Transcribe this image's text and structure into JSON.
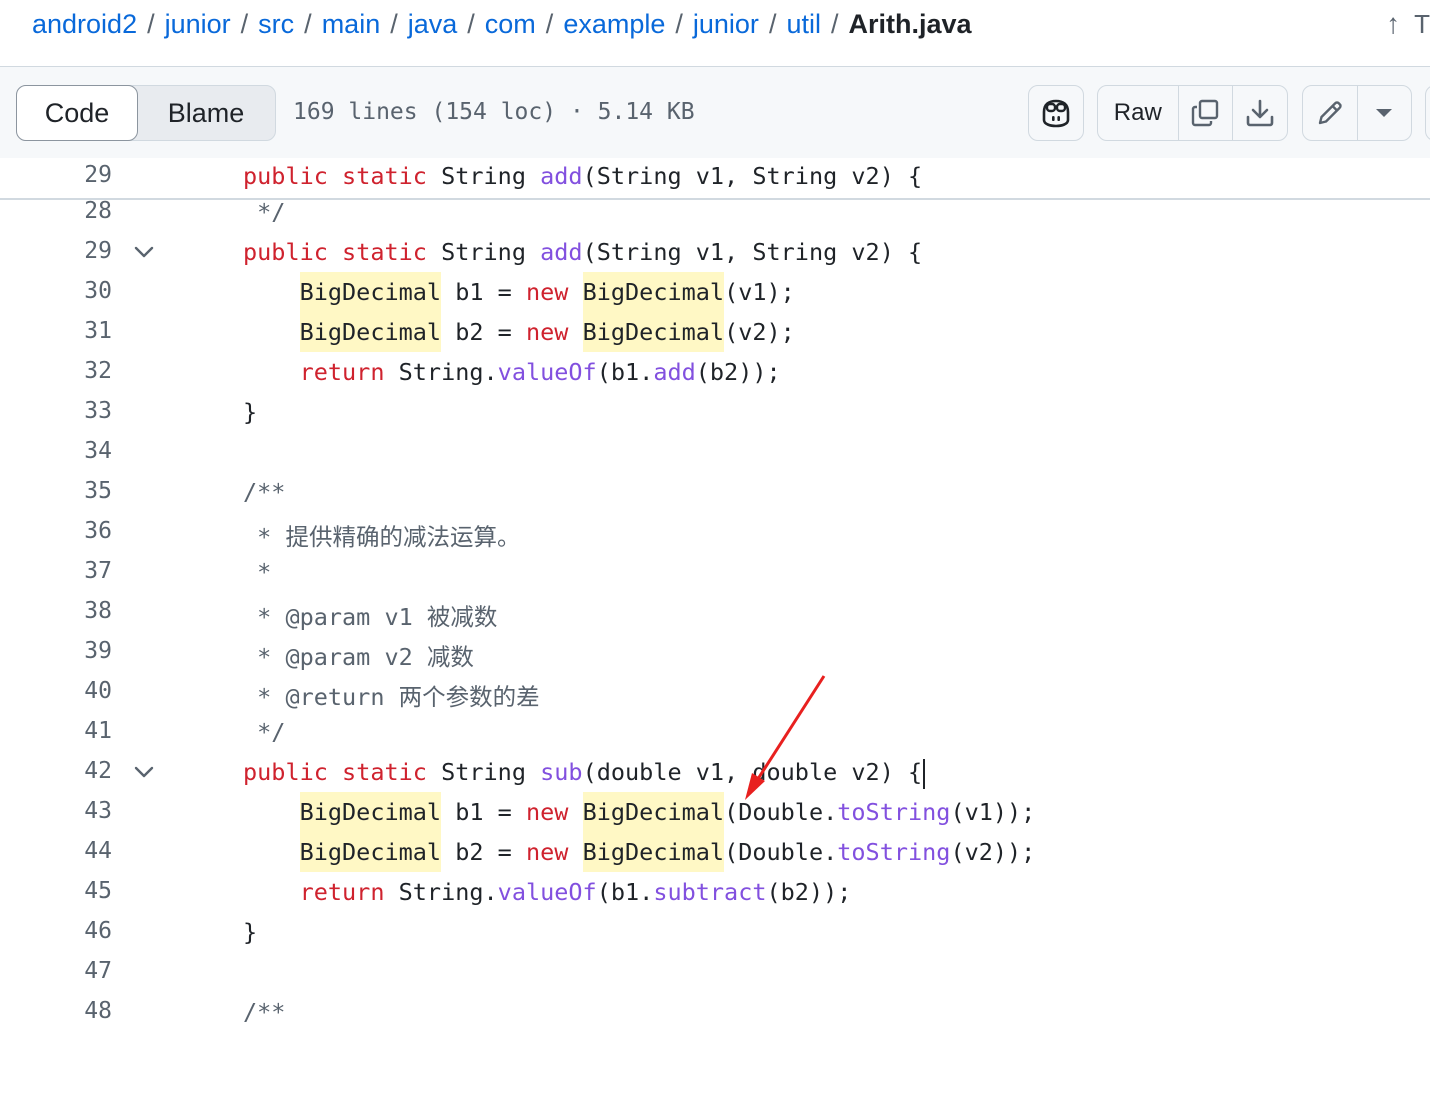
{
  "breadcrumb": {
    "parts": [
      "android2",
      "junior",
      "src",
      "main",
      "java",
      "com",
      "example",
      "junior",
      "util"
    ],
    "separator": "/",
    "current": "Arith.java"
  },
  "top_tools": {
    "truncated_text": "T"
  },
  "toolbar": {
    "code_tab": "Code",
    "blame_tab": "Blame",
    "meta": "169 lines (154 loc) · 5.14 KB",
    "raw_label": "Raw"
  },
  "sticky": {
    "line_number": "29",
    "code": "public static String add(String v1, String v2) {"
  },
  "code_lines": [
    {
      "n": "28",
      "text": " */"
    },
    {
      "n": "29",
      "text": "public static String add(String v1, String v2) {"
    },
    {
      "n": "30",
      "text": "    BigDecimal b1 = new BigDecimal(v1);"
    },
    {
      "n": "31",
      "text": "    BigDecimal b2 = new BigDecimal(v2);"
    },
    {
      "n": "32",
      "text": "    return String.valueOf(b1.add(b2));"
    },
    {
      "n": "33",
      "text": "}"
    },
    {
      "n": "34",
      "text": ""
    },
    {
      "n": "35",
      "text": "/**"
    },
    {
      "n": "36",
      "text": " * 提供精确的减法运算。"
    },
    {
      "n": "37",
      "text": " *"
    },
    {
      "n": "38",
      "text": " * @param v1 被减数"
    },
    {
      "n": "39",
      "text": " * @param v2 减数"
    },
    {
      "n": "40",
      "text": " * @return 两个参数的差"
    },
    {
      "n": "41",
      "text": " */"
    },
    {
      "n": "42",
      "text": "public static String sub(double v1, double v2) {"
    },
    {
      "n": "43",
      "text": "    BigDecimal b1 = new BigDecimal(Double.toString(v1));"
    },
    {
      "n": "44",
      "text": "    BigDecimal b2 = new BigDecimal(Double.toString(v2));"
    },
    {
      "n": "45",
      "text": "    return String.valueOf(b1.subtract(b2));"
    },
    {
      "n": "46",
      "text": "}"
    },
    {
      "n": "47",
      "text": ""
    },
    {
      "n": "48",
      "text": "/**"
    }
  ],
  "colors": {
    "link": "#0969da",
    "keyword": "#cf222e",
    "function": "#8250df",
    "comment": "#59636e",
    "highlight": "#fff8c5",
    "annotation_arrow": "#e8201f"
  },
  "icons": [
    "copilot-icon",
    "copy-icon",
    "download-icon",
    "pencil-icon",
    "triangle-down-icon",
    "chevron-down-icon",
    "arrow-up-icon"
  ]
}
